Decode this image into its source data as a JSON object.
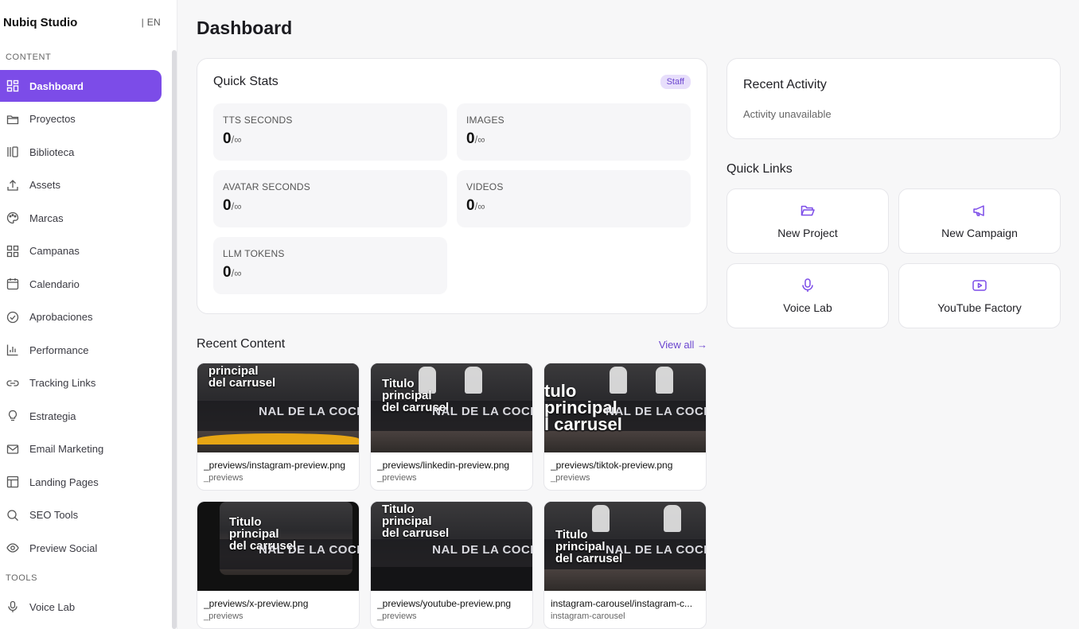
{
  "sidebar": {
    "brand": "Nubiq Studio",
    "lang": "| EN",
    "section_content": "CONTENT",
    "items": [
      {
        "label": "Dashboard",
        "icon": "grid-icon"
      },
      {
        "label": "Proyectos",
        "icon": "folder-icon"
      },
      {
        "label": "Biblioteca",
        "icon": "library-icon"
      },
      {
        "label": "Assets",
        "icon": "upload-icon"
      },
      {
        "label": "Marcas",
        "icon": "palette-icon"
      },
      {
        "label": "Campanas",
        "icon": "grid-icon"
      },
      {
        "label": "Calendario",
        "icon": "calendar-icon"
      },
      {
        "label": "Aprobaciones",
        "icon": "check-circle-icon"
      },
      {
        "label": "Performance",
        "icon": "bar-chart-icon"
      },
      {
        "label": "Tracking Links",
        "icon": "link-icon"
      },
      {
        "label": "Estrategia",
        "icon": "lightbulb-icon"
      },
      {
        "label": "Email Marketing",
        "icon": "mail-icon"
      },
      {
        "label": "Landing Pages",
        "icon": "layout-icon"
      },
      {
        "label": "SEO Tools",
        "icon": "search-icon"
      },
      {
        "label": "Preview Social",
        "icon": "eye-icon"
      }
    ],
    "section_tools": "TOOLS",
    "tools": [
      {
        "label": "Voice Lab",
        "icon": "mic-icon"
      }
    ]
  },
  "main": {
    "title": "Dashboard",
    "quick_stats": {
      "title": "Quick Stats",
      "badge": "Staff",
      "stats": [
        {
          "label": "TTS SECONDS",
          "value": "0",
          "limit": "/∞"
        },
        {
          "label": "IMAGES",
          "value": "0",
          "limit": "/∞"
        },
        {
          "label": "AVATAR SECONDS",
          "value": "0",
          "limit": "/∞"
        },
        {
          "label": "VIDEOS",
          "value": "0",
          "limit": "/∞"
        },
        {
          "label": "LLM TOKENS",
          "value": "0",
          "limit": "/∞"
        }
      ]
    },
    "recent_content": {
      "title": "Recent Content",
      "view_all": "View all →",
      "items": [
        {
          "name": "_previews/instagram-preview.png",
          "folder": "_previews",
          "overlay": "principal\ndel carrusel"
        },
        {
          "name": "_previews/linkedin-preview.png",
          "folder": "_previews",
          "overlay": "Titulo\nprincipal\ndel carrusel"
        },
        {
          "name": "_previews/tiktok-preview.png",
          "folder": "_previews",
          "overlay": "tulo\nprincipal\nl carrusel"
        },
        {
          "name": "_previews/x-preview.png",
          "folder": "_previews",
          "overlay": "Titulo\nprincipal\ndel carrusel"
        },
        {
          "name": "_previews/youtube-preview.png",
          "folder": "_previews",
          "overlay": "Titulo\nprincipal\ndel carrusel"
        },
        {
          "name": "instagram-carousel/instagram-c...",
          "folder": "instagram-carousel",
          "overlay": "Titulo\nprincipal\ndel carrusel"
        }
      ],
      "banner_text": "NAL DE LA\nCOCINA CHILENA"
    },
    "recent_activity": {
      "title": "Recent Activity",
      "text": "Activity unavailable"
    },
    "quick_links": {
      "title": "Quick Links",
      "items": [
        {
          "label": "New Project",
          "icon": "folder-open-icon"
        },
        {
          "label": "New Campaign",
          "icon": "megaphone-icon"
        },
        {
          "label": "Voice Lab",
          "icon": "mic-icon"
        },
        {
          "label": "YouTube Factory",
          "icon": "youtube-icon"
        }
      ]
    }
  }
}
